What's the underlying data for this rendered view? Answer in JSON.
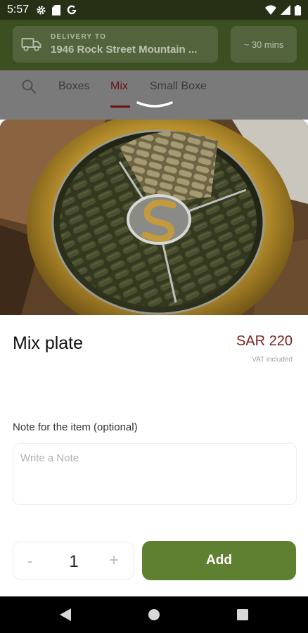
{
  "status": {
    "time": "5:57"
  },
  "header": {
    "delivery_label": "DELIVERY TO",
    "delivery_address": "1946 Rock Street Mountain ...",
    "eta": "~ 30 mins"
  },
  "tabs": [
    {
      "label": "Boxes"
    },
    {
      "label": "Mix"
    },
    {
      "label": "Small Boxe"
    }
  ],
  "product": {
    "title": "Mix plate",
    "price": "SAR 220",
    "vat_note": "VAT included"
  },
  "note": {
    "label": "Note for the item (optional)",
    "placeholder": "Write a Note"
  },
  "quantity": {
    "minus": "-",
    "value": "1",
    "plus": "+"
  },
  "actions": {
    "add_label": "Add"
  },
  "colors": {
    "header": "#3c4f21",
    "accent": "#6a1214",
    "add_button": "#5f7f31",
    "price": "#7a1e1e"
  },
  "icons": [
    "gear-icon",
    "sd-card-icon",
    "google-icon",
    "wifi-icon",
    "signal-icon",
    "battery-icon",
    "truck-icon",
    "search-icon",
    "chevron-down-icon",
    "back-icon",
    "home-icon",
    "recents-icon"
  ]
}
